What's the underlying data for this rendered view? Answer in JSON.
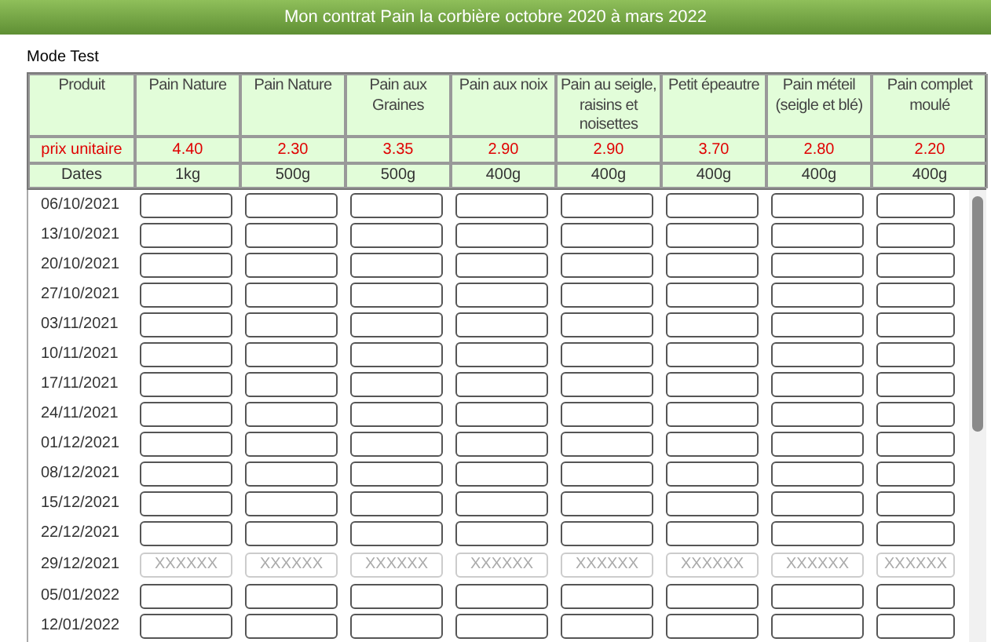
{
  "title": "Mon contrat Pain la corbière octobre 2020 à mars 2022",
  "mode": "Mode Test",
  "table": {
    "columns": [
      {
        "product": "Produit",
        "price": "prix unitaire",
        "size": "Dates"
      },
      {
        "product": "Pain Nature",
        "price": "4.40",
        "size": "1kg"
      },
      {
        "product": "Pain Nature",
        "price": "2.30",
        "size": "500g"
      },
      {
        "product": "Pain aux Graines",
        "price": "3.35",
        "size": "500g"
      },
      {
        "product": "Pain aux noix",
        "price": "2.90",
        "size": "400g"
      },
      {
        "product": "Pain au seigle, raisins et noisettes",
        "price": "2.90",
        "size": "400g"
      },
      {
        "product": "Petit épeautre",
        "price": "3.70",
        "size": "400g"
      },
      {
        "product": "Pain méteil (seigle et blé)",
        "price": "2.80",
        "size": "400g"
      },
      {
        "product": "Pain complet moulé",
        "price": "2.20",
        "size": "400g"
      }
    ],
    "rows": [
      {
        "date": "06/10/2021",
        "disabled": false
      },
      {
        "date": "13/10/2021",
        "disabled": false
      },
      {
        "date": "20/10/2021",
        "disabled": false
      },
      {
        "date": "27/10/2021",
        "disabled": false
      },
      {
        "date": "03/11/2021",
        "disabled": false
      },
      {
        "date": "10/11/2021",
        "disabled": false
      },
      {
        "date": "17/11/2021",
        "disabled": false
      },
      {
        "date": "24/11/2021",
        "disabled": false
      },
      {
        "date": "01/12/2021",
        "disabled": false
      },
      {
        "date": "08/12/2021",
        "disabled": false
      },
      {
        "date": "15/12/2021",
        "disabled": false
      },
      {
        "date": "22/12/2021",
        "disabled": false
      },
      {
        "date": "29/12/2021",
        "disabled": true,
        "placeholders": [
          "XXXXXX",
          "XXXXXX",
          "XXXXXX",
          "XXXXXX",
          "XXXXXX",
          "XXXXXX",
          "XXXXXX",
          "XXXXXX"
        ]
      },
      {
        "date": "05/01/2022",
        "disabled": false
      },
      {
        "date": "12/01/2022",
        "disabled": false
      }
    ]
  }
}
